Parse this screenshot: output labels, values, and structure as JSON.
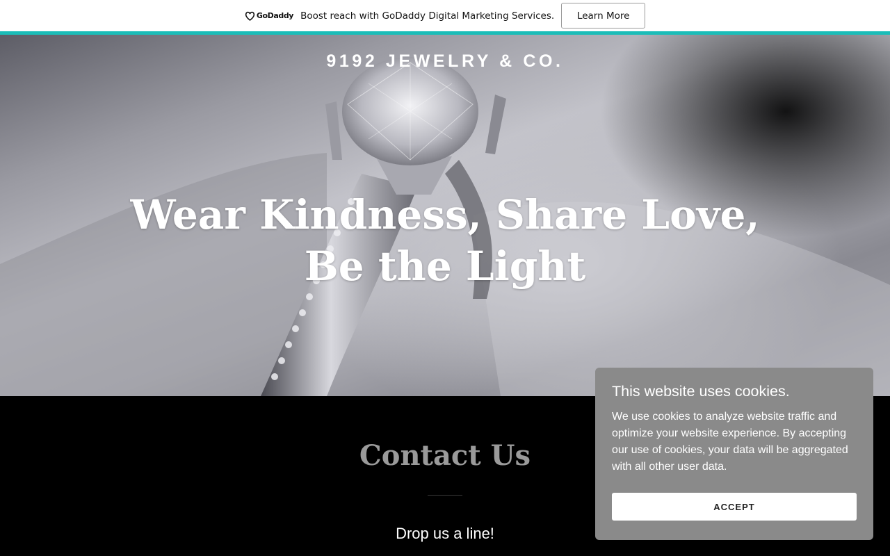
{
  "promo": {
    "logo_text": "GoDaddy",
    "message": "Boost reach with GoDaddy Digital Marketing Services.",
    "cta_label": "Learn More",
    "accent_color": "#1bbdb8"
  },
  "hero": {
    "brand": "9192 JEWELRY & CO.",
    "headline_line1": "Wear Kindness, Share Love,",
    "headline_line2": "Be the Light",
    "image": "diamond-ring-photo"
  },
  "contact": {
    "title": "Contact Us",
    "subtitle": "Drop us a line!"
  },
  "cookie_banner": {
    "title": "This website uses cookies.",
    "body": "We use cookies to analyze website traffic and optimize your website experience. By accepting our use of cookies, your data will be aggregated with all other user data.",
    "accept_label": "ACCEPT"
  }
}
